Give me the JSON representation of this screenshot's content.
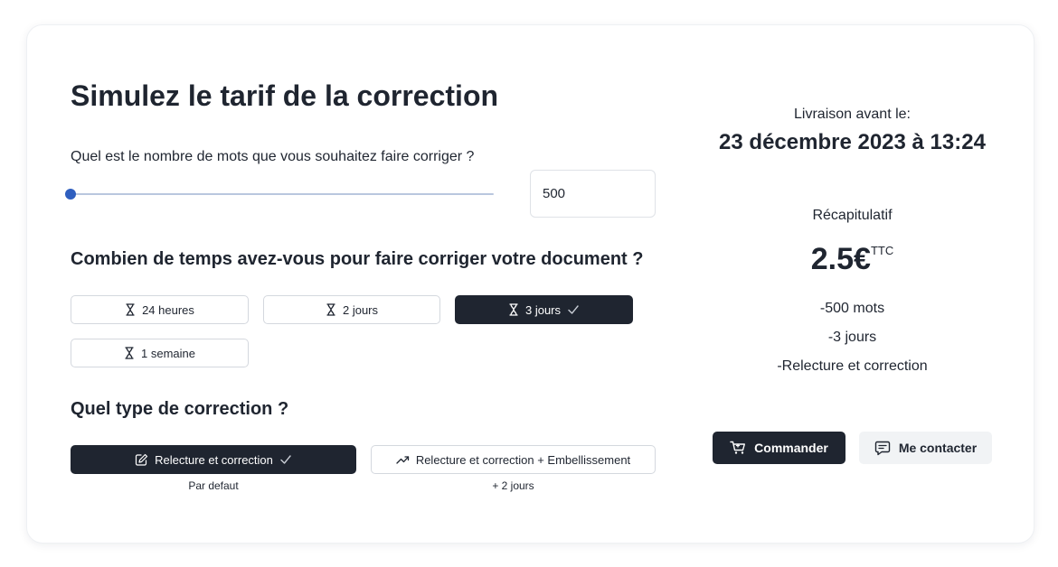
{
  "title": "Simulez le tarif de la correction",
  "word_count": {
    "question": "Quel est le nombre de mots que vous souhaitez faire corriger ?",
    "value": "500",
    "slider_fraction": 0.0
  },
  "delay": {
    "question": "Combien de temps avez-vous pour faire corriger votre document ?",
    "options": [
      {
        "label": "24 heures",
        "selected": false
      },
      {
        "label": "2 jours",
        "selected": false
      },
      {
        "label": "3 jours",
        "selected": true
      },
      {
        "label": "1 semaine",
        "selected": false
      }
    ]
  },
  "correction_type": {
    "question": "Quel type de correction ?",
    "options": [
      {
        "label": "Relecture et correction",
        "note": "Par defaut",
        "selected": true,
        "icon": "edit-icon"
      },
      {
        "label": "Relecture et correction + Embellissement",
        "note": "+ 2 jours",
        "selected": false,
        "icon": "trending-up-icon"
      }
    ]
  },
  "delivery": {
    "label": "Livraison avant le:",
    "date": "23 décembre 2023 à 13:24"
  },
  "summary": {
    "heading": "Récapitulatif",
    "price": "2.5€",
    "price_suffix": "TTC",
    "lines": [
      "-500 mots",
      "-3 jours",
      "-Relecture et correction"
    ]
  },
  "actions": {
    "order_label": "Commander",
    "contact_label": "Me contacter"
  },
  "colors": {
    "dark": "#1f2530",
    "accent": "#2f5fbf",
    "muted_bg": "#f1f3f5"
  }
}
